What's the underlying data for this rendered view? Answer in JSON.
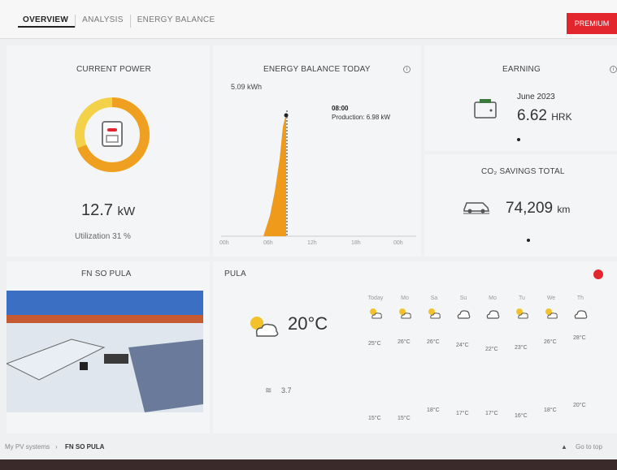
{
  "tabs": [
    "OVERVIEW",
    "ANALYSIS",
    "ENERGY BALANCE"
  ],
  "premium_label": "PREMIUM",
  "current_power": {
    "title": "CURRENT POWER",
    "value": "12.7",
    "unit": "kW",
    "utilization": "Utilization 31 %",
    "gauge_fraction": 0.31
  },
  "energy_balance": {
    "title": "ENERGY BALANCE TODAY",
    "max_label": "5.09 kWh",
    "tooltip_time": "08:00",
    "tooltip_text": "Production: 6.98 kW",
    "x_ticks": [
      "00h",
      "06h",
      "12h",
      "18h",
      "00h"
    ]
  },
  "earning": {
    "title": "EARNING",
    "period": "June 2023",
    "value": "6.62",
    "currency": "HRK"
  },
  "co2": {
    "title": "CO₂ SAVINGS TOTAL",
    "value": "74,209",
    "unit": "km"
  },
  "plant": {
    "title": "FN SO PULA"
  },
  "weather": {
    "location": "PULA",
    "current_temp": "20°C",
    "wind": "3.7",
    "days": [
      {
        "name": "Today",
        "icon": "partly-sunny-icon",
        "high": "25°C",
        "low": "15°C"
      },
      {
        "name": "Mo",
        "icon": "partly-sunny-icon",
        "high": "26°C",
        "low": "15°C"
      },
      {
        "name": "Sa",
        "icon": "partly-sunny-icon",
        "high": "26°C",
        "low": "18°C"
      },
      {
        "name": "Su",
        "icon": "cloudy-icon",
        "high": "24°C",
        "low": "17°C"
      },
      {
        "name": "Mo",
        "icon": "cloudy-icon",
        "high": "22°C",
        "low": "17°C"
      },
      {
        "name": "Tu",
        "icon": "partly-sunny-icon",
        "high": "23°C",
        "low": "16°C"
      },
      {
        "name": "We",
        "icon": "partly-sunny-icon",
        "high": "26°C",
        "low": "18°C"
      },
      {
        "name": "Th",
        "icon": "cloudy-icon",
        "high": "28°C",
        "low": "20°C"
      }
    ]
  },
  "footer": {
    "breadcrumb_root": "My PV systems",
    "breadcrumb_current": "FN SO PULA",
    "goto_label": "Go to top"
  },
  "colors": {
    "accent": "#e3262e",
    "gauge_orange": "#f0a020",
    "gauge_yellow": "#f3d24a",
    "chart_fill": "#f09a1c"
  }
}
